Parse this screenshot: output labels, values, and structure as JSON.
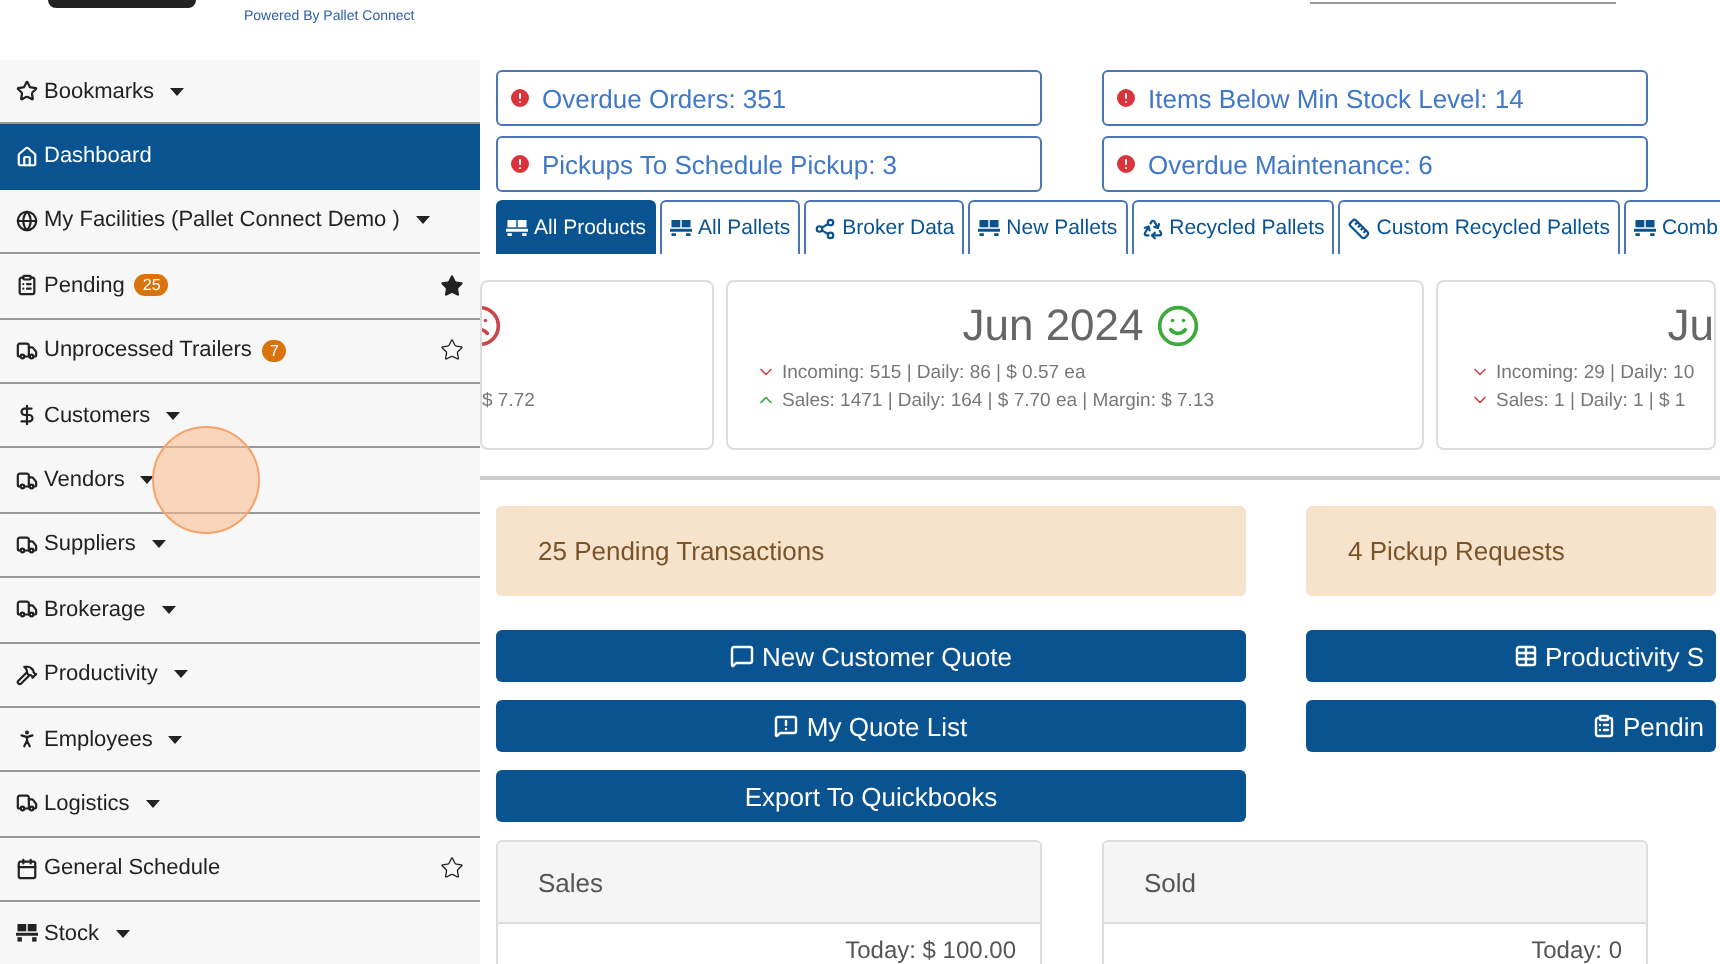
{
  "header": {
    "tagline": "Powered By Pallet Connect"
  },
  "sidebar": {
    "items": [
      {
        "label": "Bookmarks",
        "selected": false,
        "dropdown": true
      },
      {
        "label": "Dashboard",
        "selected": true,
        "dropdown": false
      },
      {
        "label": "My Facilities (Pallet Connect Demo )",
        "selected": false,
        "dropdown": true
      },
      {
        "label": "Pending",
        "selected": false,
        "dropdown": false,
        "badge": "25",
        "starred": true
      },
      {
        "label": "Unprocessed Trailers",
        "selected": false,
        "dropdown": false,
        "badge": "7",
        "starred": false
      },
      {
        "label": "Customers",
        "selected": false,
        "dropdown": true
      },
      {
        "label": "Vendors",
        "selected": false,
        "dropdown": true
      },
      {
        "label": "Suppliers",
        "selected": false,
        "dropdown": true
      },
      {
        "label": "Brokerage",
        "selected": false,
        "dropdown": true
      },
      {
        "label": "Productivity",
        "selected": false,
        "dropdown": true
      },
      {
        "label": "Employees",
        "selected": false,
        "dropdown": true
      },
      {
        "label": "Logistics",
        "selected": false,
        "dropdown": true
      },
      {
        "label": "General Schedule",
        "selected": false,
        "dropdown": false,
        "starred": false
      },
      {
        "label": "Stock",
        "selected": false,
        "dropdown": true
      }
    ]
  },
  "alerts": [
    {
      "label": "Overdue Orders: 351"
    },
    {
      "label": "Items Below Min Stock Level: 14"
    },
    {
      "label": "Pickups To Schedule Pickup: 3"
    },
    {
      "label": "Overdue Maintenance: 6"
    }
  ],
  "tabs": [
    {
      "label": "All Products",
      "selected": true
    },
    {
      "label": "All Pallets",
      "selected": false
    },
    {
      "label": "Broker Data",
      "selected": false
    },
    {
      "label": "New Pallets",
      "selected": false
    },
    {
      "label": "Recycled Pallets",
      "selected": false
    },
    {
      "label": "Custom Recycled Pallets",
      "selected": false
    },
    {
      "label": "Comb",
      "selected": false
    }
  ],
  "months": [
    {
      "happy": false,
      "lines": [
        {
          "text": "$ 7.72"
        }
      ]
    },
    {
      "title": "Jun 2024",
      "happy": true,
      "lines": [
        {
          "rising": false,
          "text": "Incoming: 515 | Daily: 86 | $ 0.57 ea"
        },
        {
          "rising": true,
          "text": "Sales: 1471 | Daily: 164 | $ 7.70 ea | Margin: $ 7.13"
        }
      ]
    },
    {
      "title": "Ju",
      "lines": [
        {
          "rising": false,
          "text": "Incoming: 29 | Daily: 10"
        },
        {
          "rising": false,
          "text": "Sales: 1 | Daily: 1 | $ 1"
        }
      ]
    }
  ],
  "notices": [
    {
      "label": "25 Pending Transactions"
    },
    {
      "label": "4 Pickup Requests"
    }
  ],
  "action_columns": [
    [
      {
        "label": "New Customer Quote"
      },
      {
        "label": "My Quote List"
      },
      {
        "label": "Export To Quickbooks"
      }
    ],
    [
      {
        "label": "Productivity S"
      },
      {
        "label": "Pendin"
      }
    ]
  ],
  "summary_cards": [
    {
      "title": "Sales",
      "value": "Today: $ 100.00"
    },
    {
      "title": "Sold",
      "value": "Today: 0"
    }
  ]
}
